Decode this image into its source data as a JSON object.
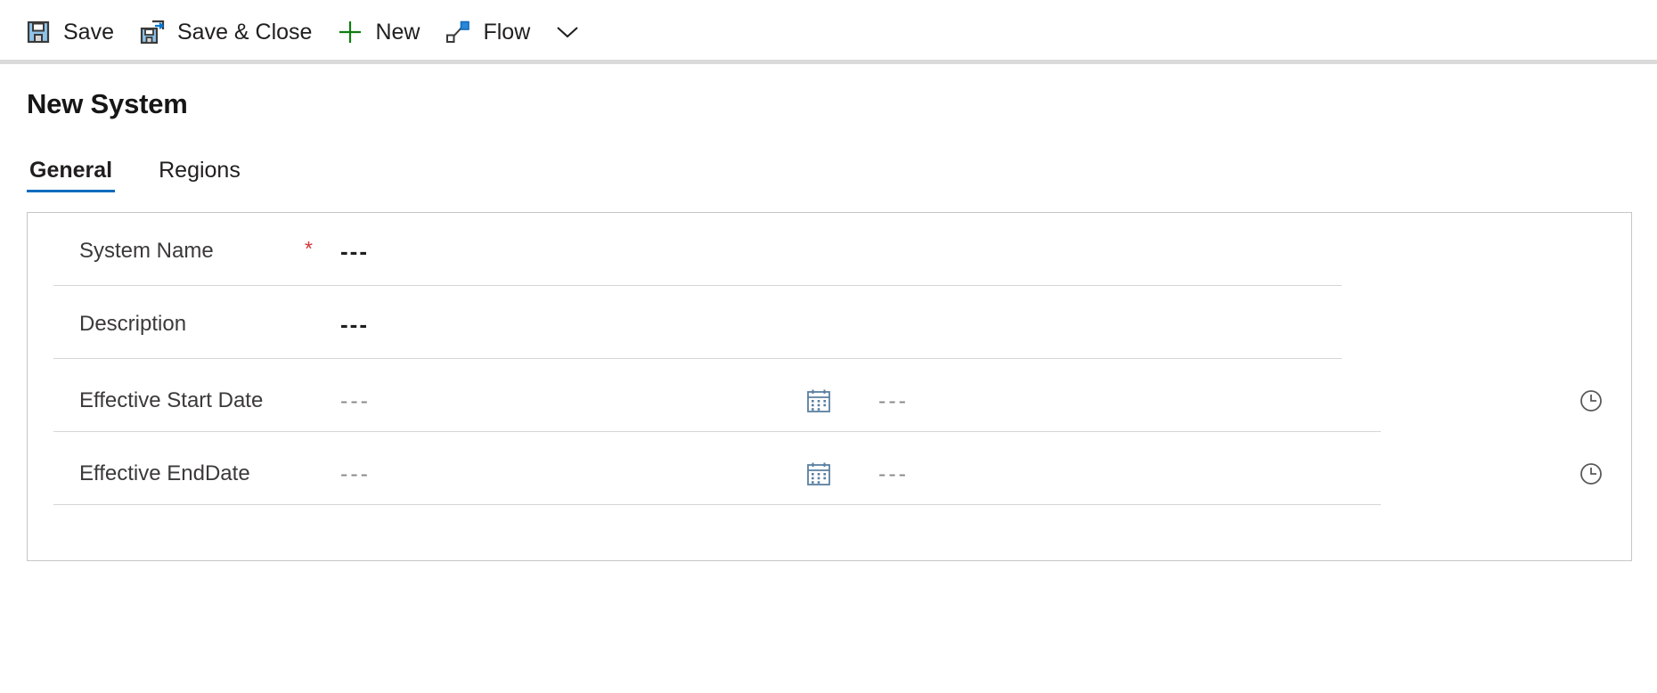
{
  "command_bar": {
    "buttons": [
      {
        "label": "Save",
        "icon": "save-floppy-icon"
      },
      {
        "label": "Save & Close",
        "icon": "save-and-close-icon"
      },
      {
        "label": "New",
        "icon": "plus-icon"
      },
      {
        "label": "Flow",
        "icon": "flow-icon"
      }
    ],
    "overflow_icon": "chevron-down-icon"
  },
  "header": {
    "title": "New System"
  },
  "tabs": [
    {
      "label": "General",
      "active": true
    },
    {
      "label": "Regions",
      "active": false
    }
  ],
  "form": {
    "fields": [
      {
        "label": "System Name",
        "required_marker": "*",
        "value": "---",
        "type": "text"
      },
      {
        "label": "Description",
        "required_marker": "",
        "value": "---",
        "type": "text"
      },
      {
        "label": "Effective Start Date",
        "required_marker": "",
        "date_value": "---",
        "time_value": "---",
        "date_icon": "calendar-icon",
        "time_icon": "clock-icon",
        "type": "datetime"
      },
      {
        "label": "Effective EndDate",
        "required_marker": "",
        "date_value": "---",
        "time_value": "---",
        "date_icon": "calendar-icon",
        "time_icon": "clock-icon",
        "type": "datetime"
      }
    ]
  },
  "colors": {
    "accent": "#0f6cbd",
    "required": "#d13438",
    "text": "#201f1e",
    "muted": "#8a8886",
    "border": "#c8c6c4",
    "separator": "#d6d6d6",
    "toolbar_rule": "#dadada",
    "icon_blue": "#0078d4",
    "icon_light_blue": "#8ec3ea",
    "icon_dark": "#3b3a39",
    "plus_green": "#107c10"
  }
}
